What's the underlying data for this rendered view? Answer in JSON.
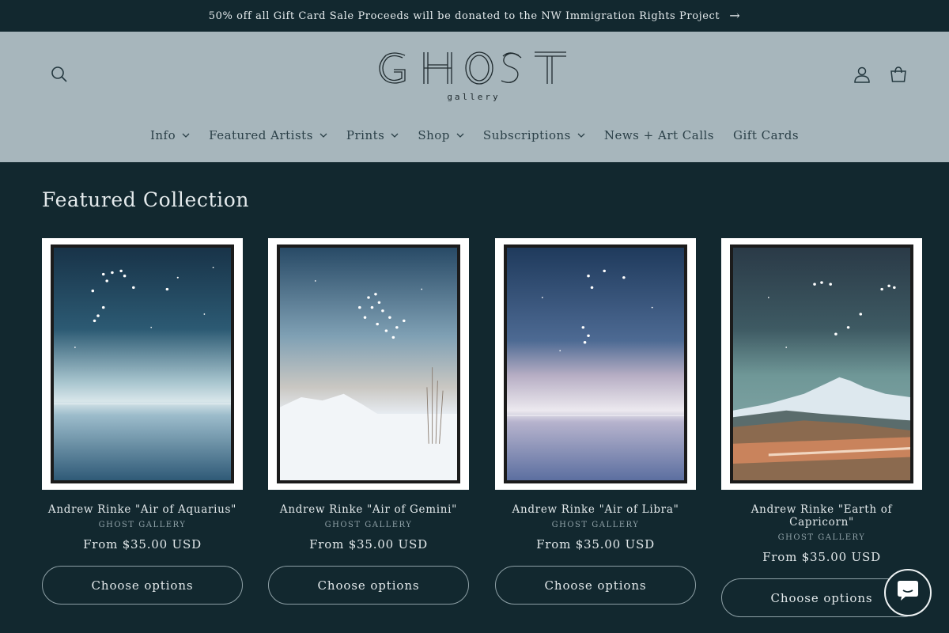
{
  "announcement": {
    "text": "50% off all Gift Card Sale Proceeds will be donated to the NW Immigration Rights Project",
    "arrow": "→"
  },
  "header": {
    "logo_text": "GHOST",
    "logo_sub": "gallery",
    "icons": [
      "search-icon",
      "account-icon",
      "cart-icon"
    ]
  },
  "nav": {
    "items": [
      {
        "label": "Info",
        "has_dropdown": true
      },
      {
        "label": "Featured Artists",
        "has_dropdown": true
      },
      {
        "label": "Prints",
        "has_dropdown": true
      },
      {
        "label": "Shop",
        "has_dropdown": true
      },
      {
        "label": "Subscriptions",
        "has_dropdown": true
      },
      {
        "label": "News + Art Calls",
        "has_dropdown": false
      },
      {
        "label": "Gift Cards",
        "has_dropdown": false
      }
    ]
  },
  "collection": {
    "title": "Featured Collection",
    "products": [
      {
        "title": "Andrew Rinke \"Air of Aquarius\"",
        "vendor": "GHOST GALLERY",
        "price": "From $35.00 USD",
        "button": "Choose options"
      },
      {
        "title": "Andrew Rinke \"Air of Gemini\"",
        "vendor": "GHOST GALLERY",
        "price": "From $35.00 USD",
        "button": "Choose options"
      },
      {
        "title": "Andrew Rinke \"Air of Libra\"",
        "vendor": "GHOST GALLERY",
        "price": "From $35.00 USD",
        "button": "Choose options"
      },
      {
        "title": "Andrew Rinke \"Earth of Capricorn\"",
        "vendor": "GHOST GALLERY",
        "price": "From $35.00 USD",
        "button": "Choose options"
      }
    ]
  },
  "colors": {
    "page_bg": "#12282f",
    "header_bg": "#a7b6bc",
    "text_light": "#e3e9eb",
    "text_dark": "#24383f"
  },
  "chat": {
    "icon": "chat-icon"
  }
}
